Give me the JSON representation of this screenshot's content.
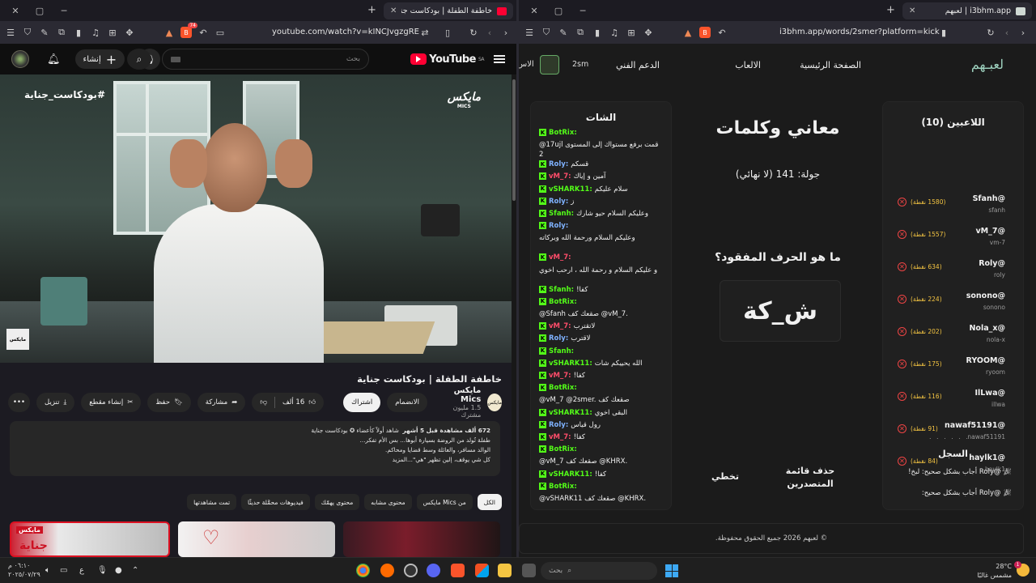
{
  "left": {
    "tabs": [
      {
        "title": "خاطفة الطفلة | بودكاست جناية"
      }
    ],
    "url": "youtube.com/watch?v=kINCJvgzgRE",
    "ext_badge": "74",
    "youtube": {
      "logo": "YouTube",
      "region": "SA",
      "search_placeholder": "بحث",
      "create_label": "إنشاء",
      "video_hashtag": "#بودكاست_جناية",
      "video_brand": "مايكس",
      "video_brand_sub": "MICS",
      "watermark": "مايكس",
      "title": "خاطفة الطفلة | بودكاست جناية",
      "channel_name": "مايكس Mics",
      "channel_subs": "1.5 مليون مشترك",
      "channel_logo_text": "مايكس",
      "join_label": "الانضمام",
      "subscribe_label": "اشتراك",
      "likes": "16 ألف",
      "share_label": "مشاركة",
      "save_label": "حفظ",
      "clip_label": "إنشاء مقطع",
      "download_label": "تنزيل",
      "description": {
        "stats": "672 ألف مشاهدة  قبل 5 أشهر",
        "line0": "شاهد أولاً كأعضاء ✪ بودكاست جناية",
        "line1": "طفلة تُولد من الروضة بسيارة أبوها... بس الأم تفكر...",
        "line2": "الوالد مسافر، والعائلة وسط قضايا ومحاكم.",
        "line3": "كل شي يوقف، إلين تظهر \"هي\"...المزيد"
      },
      "chips": [
        "الكل",
        "من Mics مايكس",
        "محتوى مشابه",
        "محتوى يهمّك",
        "فيديوهات محمَّلة حديثًا",
        "تمت مشاهدتها"
      ],
      "thumb1_text": "مايكس",
      "thumb1_text2": "جناية"
    }
  },
  "right": {
    "tabs": [
      {
        "title": "i3bhm.app | لعبهم"
      }
    ],
    "url": "i3bhm.app/words/2smer?platform=kick",
    "site": {
      "logo": "لعبـهم",
      "nav": [
        "الصفحة الرئيسية",
        "الالعاب",
        "الدعم الفني"
      ],
      "user_short": "2sm",
      "user_cut": "الاس",
      "players_title": "اللاعبين (10)",
      "players": [
        {
          "name": "@Sfanh",
          "handle": "sfanh",
          "points": "(1580 نقطة)"
        },
        {
          "name": "@vM_7",
          "handle": "vm-7",
          "points": "(1557 نقطة)"
        },
        {
          "name": "@Roly",
          "handle": "roly",
          "points": "(634 نقطة)"
        },
        {
          "name": "@sonono",
          "handle": "sonono",
          "points": "(224 نقطة)"
        },
        {
          "name": "@Nola_x",
          "handle": "nola-x",
          "points": "(202 نقطة)"
        },
        {
          "name": "@RYOOM",
          "handle": "ryoom",
          "points": "(175 نقطة)"
        },
        {
          "name": "@IlLwa",
          "handle": "illwa",
          "points": "(116 نقطة)"
        },
        {
          "name": "@nawaf51191",
          "handle": "nawaf51191",
          "points": "(91 نقطة)"
        },
        {
          "name": "@haylk1",
          "handle": "haylk1",
          "points": "(84 نقطة)"
        }
      ],
      "more_dots": ". . . . . . .",
      "log_title": "السجل",
      "log": [
        "@Roly أجاب بشكل صحيح: لبخ!",
        "@Roly أجاب بشكل صحيح:"
      ],
      "game_title": "معاني وكلمات",
      "round": "جولة: 141 (لا نهائي)",
      "question": "ما هو الحرف المفقود؟",
      "word": "ش_كة",
      "btn_skip": "تخطي",
      "btn_clear": "حذف قائمة المتصدرين",
      "chat_title": "الشات",
      "chat": [
        {
          "user": "BotRix:",
          "text": "",
          "color": "#53fc18"
        },
        {
          "user": "",
          "text": "@17ujl قمت برفع مستواك إلى المستوى 2",
          "color": "#f1f1f1"
        },
        {
          "user": "Roly:",
          "text": "قسكم",
          "color": "#7fb2ff"
        },
        {
          "user": "vM_7:",
          "text": "آمين و إياك",
          "color": "#ff4d6a"
        },
        {
          "user": "vSHARK11:",
          "text": "سلام عليكم",
          "color": "#53fc18"
        },
        {
          "user": "Roly:",
          "text": "ز",
          "color": "#7fb2ff"
        },
        {
          "user": "Sfanh:",
          "text": "وعليكم السلام حيو شارك",
          "color": "#53fc18"
        },
        {
          "user": "Roly:",
          "text": "",
          "color": "#7fb2ff"
        },
        {
          "user": "",
          "text": "وعليكم السلام ورحمة الله وبركاته",
          "color": "#f1f1f1"
        },
        {
          "user": "vM_7:",
          "text": "",
          "color": "#ff4d6a"
        },
        {
          "user": "",
          "text": "و عليكم السلام و رحمة الله ، ارحب اخوي",
          "color": "#f1f1f1"
        },
        {
          "user": "Sfanh:",
          "text": "كفا!",
          "color": "#53fc18"
        },
        {
          "user": "BotRix:",
          "text": "",
          "color": "#53fc18"
        },
        {
          "user": "",
          "text": "@Sfanh صقعك كف @vM_7.",
          "color": "#f1f1f1"
        },
        {
          "user": "vM_7:",
          "text": "لاتقترب",
          "color": "#ff4d6a"
        },
        {
          "user": "Roly:",
          "text": "لاقترب",
          "color": "#7fb2ff"
        },
        {
          "user": "Sfanh:",
          "text": "",
          "color": "#53fc18"
        },
        {
          "user": "vSHARK11:",
          "text": "الله يحييكم شات",
          "color": "#53fc18"
        },
        {
          "user": "vM_7:",
          "text": "كفا!",
          "color": "#ff4d6a"
        },
        {
          "user": "BotRix:",
          "text": "",
          "color": "#53fc18"
        },
        {
          "user": "",
          "text": "@vM_7 @2smer. صقعك كف",
          "color": "#f1f1f1"
        },
        {
          "user": "vSHARK11:",
          "text": "البقى اخوي",
          "color": "#53fc18"
        },
        {
          "user": "Roly:",
          "text": "رول قياس",
          "color": "#7fb2ff"
        },
        {
          "user": "vM_7:",
          "text": "كفا!",
          "color": "#ff4d6a"
        },
        {
          "user": "BotRix:",
          "text": "",
          "color": "#53fc18"
        },
        {
          "user": "",
          "text": "@vM_7 صقعك كف @KHRX.",
          "color": "#f1f1f1"
        },
        {
          "user": "vSHARK11:",
          "text": "كفا!",
          "color": "#53fc18"
        },
        {
          "user": "BotRix:",
          "text": "",
          "color": "#53fc18"
        },
        {
          "user": "",
          "text": "@vSHARK11 صقعك كف @KHRX.",
          "color": "#f1f1f1"
        }
      ],
      "footer": "© لعبهم 2026 جميع الحقوق محفوظة."
    }
  },
  "taskbar": {
    "time": "٠٦:١٠ م",
    "date": "٢٠٢٥/٠٧/٢٩",
    "lang": "ع",
    "search_placeholder": "بحث",
    "temp": "28°C",
    "weather": "مشمس غالبًا",
    "notif_count": "1"
  }
}
